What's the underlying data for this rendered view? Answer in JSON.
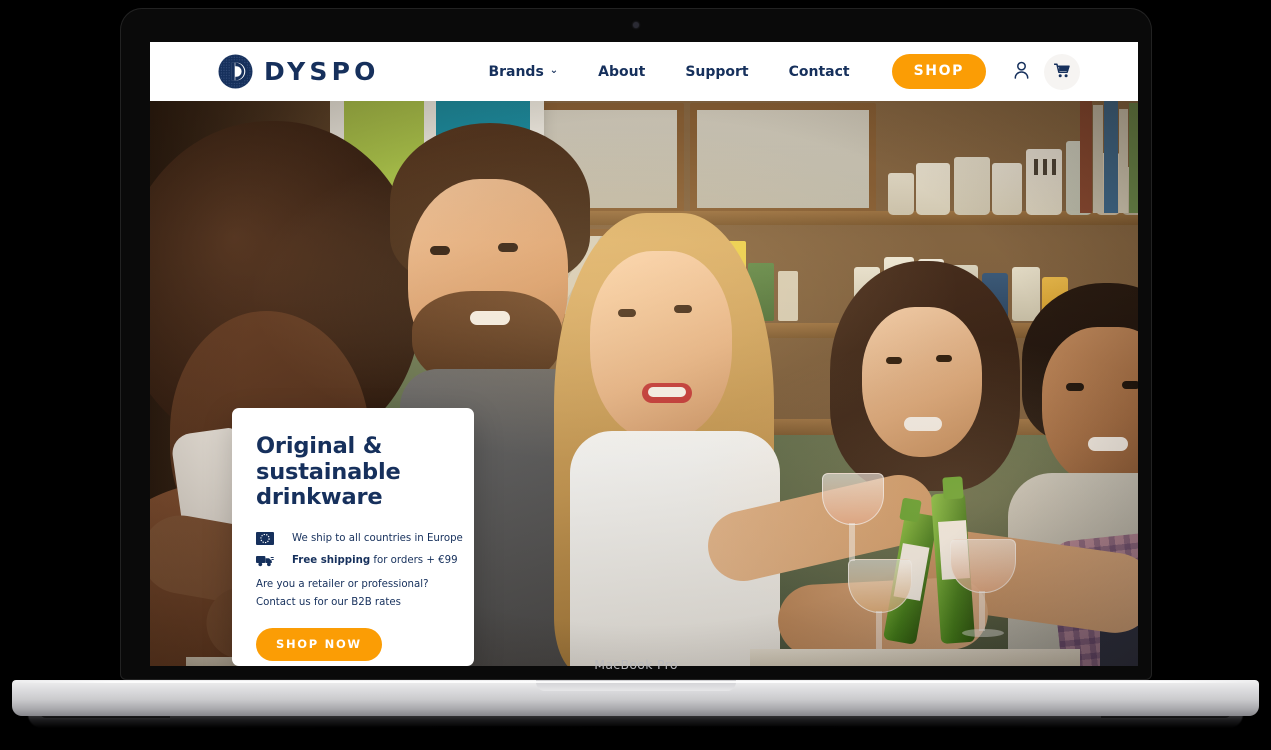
{
  "device": {
    "bezel_label": "MacBook Pro",
    "camera_icon": "camera-dot-icon"
  },
  "site": {
    "brand": {
      "wordmark": "DYSPO",
      "logo_icon": "dyspo-circle-d-logo-icon"
    },
    "nav": {
      "items": [
        {
          "label": "Brands",
          "has_dropdown": true,
          "chevron": "⌄"
        },
        {
          "label": "About",
          "has_dropdown": false
        },
        {
          "label": "Support",
          "has_dropdown": false
        },
        {
          "label": "Contact",
          "has_dropdown": false
        }
      ],
      "shop_button": "SHOP",
      "account_icon": "user-account-icon",
      "cart_icon": "shopping-cart-icon"
    },
    "hero": {
      "title_line1": "Original &",
      "title_line2": "sustainable",
      "title_line3": "drinkware",
      "features": [
        {
          "icon": "eu-flag-icon",
          "text": "We ship to all countries in Europe",
          "bold_prefix": ""
        },
        {
          "icon": "delivery-truck-icon",
          "text": " for orders + €99",
          "bold_prefix": "Free shipping"
        }
      ],
      "b2b_line1": "Are you a retailer or professional?",
      "b2b_line2": "Contact us for our B2B rates",
      "cta_button": "SHOP NOW",
      "photo_alt": "Group of friends toasting with beer bottles and wine glasses in a kitchen"
    }
  },
  "colors": {
    "navy": "#16305C",
    "orange": "#FB9D05",
    "white": "#FFFFFF",
    "cart_bg": "#F6F4F2"
  }
}
